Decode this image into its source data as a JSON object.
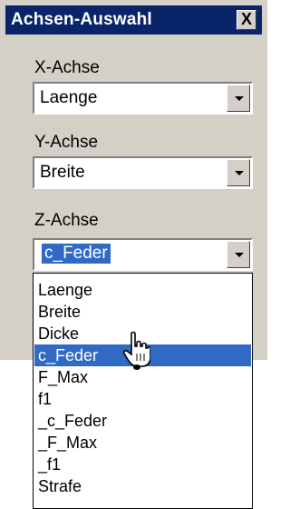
{
  "window": {
    "title": "Achsen-Auswahl",
    "close_label": "X"
  },
  "x_axis": {
    "label": "X-Achse",
    "value": "Laenge"
  },
  "y_axis": {
    "label": "Y-Achse",
    "value": "Breite"
  },
  "z_axis": {
    "label": "Z-Achse",
    "value": "c_Feder"
  },
  "dropdown": {
    "highlighted": "c_Feder",
    "options": [
      "Laenge",
      "Breite",
      "Dicke",
      "c_Feder",
      "F_Max",
      "f1",
      "_c_Feder",
      "_F_Max",
      "_f1",
      "Strafe"
    ]
  },
  "colors": {
    "title_bg": "#0a246a",
    "selection": "#316ac5",
    "face": "#d4d0c8"
  },
  "cursor": "hand-pointer-icon"
}
